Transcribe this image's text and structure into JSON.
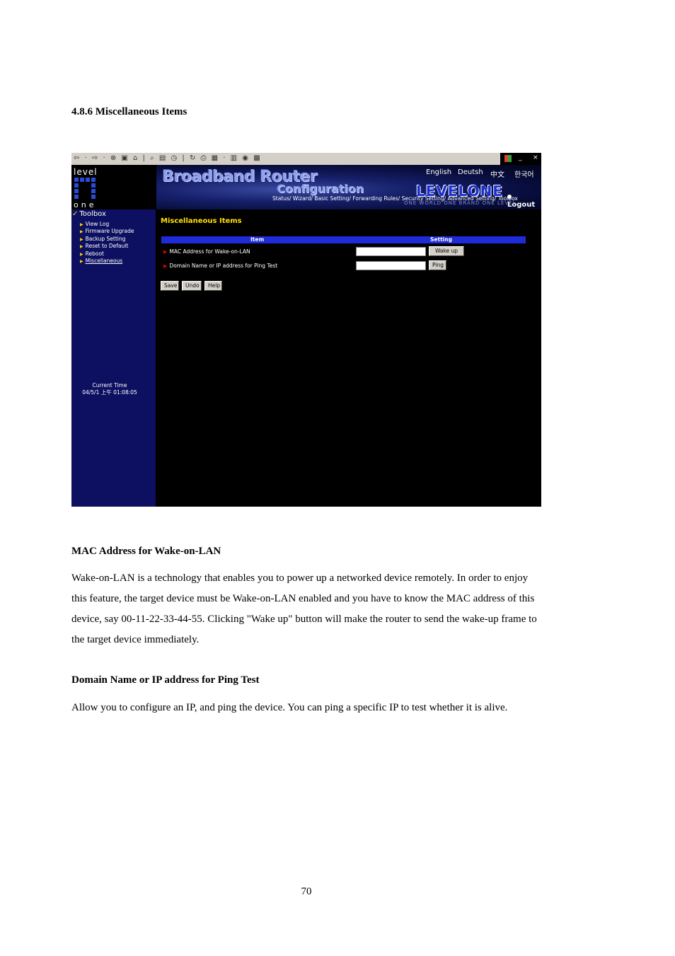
{
  "document": {
    "section_heading": "4.8.6 Miscellaneous Items",
    "sub1_heading": "MAC Address for Wake-on-LAN",
    "sub1_text": "Wake-on-LAN is a technology that enables you to power up a networked device remotely. In order to enjoy this feature, the target device must be Wake-on-LAN enabled and you have to know the MAC address of this device, say 00-11-22-33-44-55. Clicking \"Wake up\" button will make the router to send the wake-up frame to the target device immediately.",
    "sub2_heading": "Domain Name or IP address for Ping Test",
    "sub2_text": "Allow you to configure an IP, and ping the device. You can ping a specific IP to test whether it is alive.",
    "page_number": "70"
  },
  "screenshot": {
    "toolbar": {
      "icons": "⇦ · ⇨ · ⊗ ▣ ⌂ | ⌕ ▤ ◷ | ↻ ⎙ ▦ · ▥ ◉ ▩",
      "window_controls": [
        "_",
        "×"
      ]
    },
    "banner": {
      "logo_top": "level",
      "logo_bottom": "one",
      "title": "Broadband Router",
      "subtitle": "Configuration",
      "languages": [
        "English",
        "Deutsh",
        "中文",
        "한국어"
      ],
      "brand": "LEVELONE",
      "tagline": "ONE WORLD  ONE BRAND  ONE LEVEL",
      "nav": "Status/ Wizard/ Basic Setting/ Forwarding Rules/ Security Setting/ Advanced Setting/ Toolbox",
      "logout": "Logout"
    },
    "sidebar": {
      "title": "Toolbox",
      "items": [
        "View Log",
        "Firmware Upgrade",
        "Backup Setting",
        "Reset to Default",
        "Reboot",
        "Miscellaneous"
      ],
      "current_time_label": "Current Time",
      "current_time_value": "04/5/1 上午 01:08:05"
    },
    "main": {
      "title": "Miscellaneous Items",
      "col_item": "Item",
      "col_setting": "Setting",
      "row1_label": "MAC Address for Wake-on-LAN",
      "row1_value": "",
      "row1_button": "Wake up",
      "row2_label": "Domain Name or IP address for Ping Test",
      "row2_value": "",
      "row2_button": "Ping",
      "save": "Save",
      "undo": "Undo",
      "help": "Help"
    }
  }
}
